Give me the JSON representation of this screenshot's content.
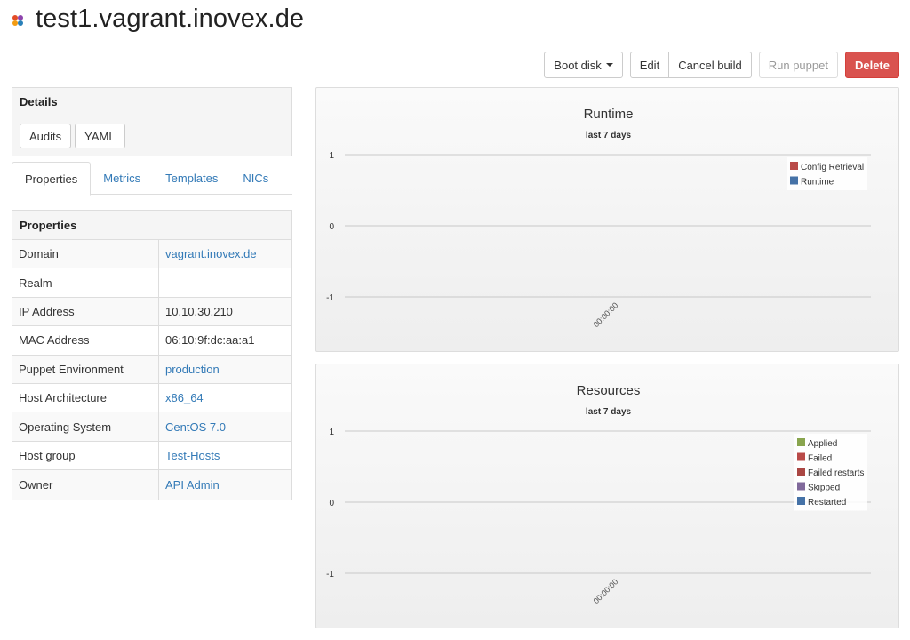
{
  "header": {
    "title": "test1.vagrant.inovex.de",
    "icon": "host-icon"
  },
  "toolbar": {
    "boot_disk": "Boot disk",
    "edit": "Edit",
    "cancel_build": "Cancel build",
    "run_puppet": "Run puppet",
    "delete": "Delete"
  },
  "details": {
    "title": "Details",
    "audits": "Audits",
    "yaml": "YAML"
  },
  "tabs": [
    {
      "label": "Properties",
      "active": true
    },
    {
      "label": "Metrics"
    },
    {
      "label": "Templates"
    },
    {
      "label": "NICs"
    }
  ],
  "properties": {
    "title": "Properties",
    "rows": [
      {
        "key": "Domain",
        "value": "vagrant.inovex.de",
        "link": true
      },
      {
        "key": "Realm",
        "value": "",
        "link": false
      },
      {
        "key": "IP Address",
        "value": "10.10.30.210",
        "link": false
      },
      {
        "key": "MAC Address",
        "value": "06:10:9f:dc:aa:a1",
        "link": false
      },
      {
        "key": "Puppet Environment",
        "value": "production",
        "link": true
      },
      {
        "key": "Host Architecture",
        "value": "x86_64",
        "link": true
      },
      {
        "key": "Operating System",
        "value": "CentOS 7.0",
        "link": true
      },
      {
        "key": "Host group",
        "value": "Test-Hosts",
        "link": true
      },
      {
        "key": "Owner",
        "value": "API Admin",
        "link": true
      }
    ]
  },
  "chart_data": [
    {
      "type": "line",
      "title": "Runtime",
      "subtitle": "last 7 days",
      "yticks": [
        1,
        0,
        -1
      ],
      "ylim": [
        -1,
        1
      ],
      "xticks": [
        "00:00:00"
      ],
      "legend_position": "top-right",
      "series": [
        {
          "name": "Config Retrieval",
          "color": "#b94a48",
          "values": []
        },
        {
          "name": "Runtime",
          "color": "#4572a7",
          "values": []
        }
      ]
    },
    {
      "type": "line",
      "title": "Resources",
      "subtitle": "last 7 days",
      "yticks": [
        1,
        0,
        -1
      ],
      "ylim": [
        -1,
        1
      ],
      "xticks": [
        "00:00:00"
      ],
      "legend_position": "top-right",
      "series": [
        {
          "name": "Applied",
          "color": "#89a54e",
          "values": []
        },
        {
          "name": "Failed",
          "color": "#b94a48",
          "values": []
        },
        {
          "name": "Failed restarts",
          "color": "#aa4643",
          "values": []
        },
        {
          "name": "Skipped",
          "color": "#80699b",
          "values": []
        },
        {
          "name": "Restarted",
          "color": "#4572a7",
          "values": []
        }
      ]
    }
  ]
}
